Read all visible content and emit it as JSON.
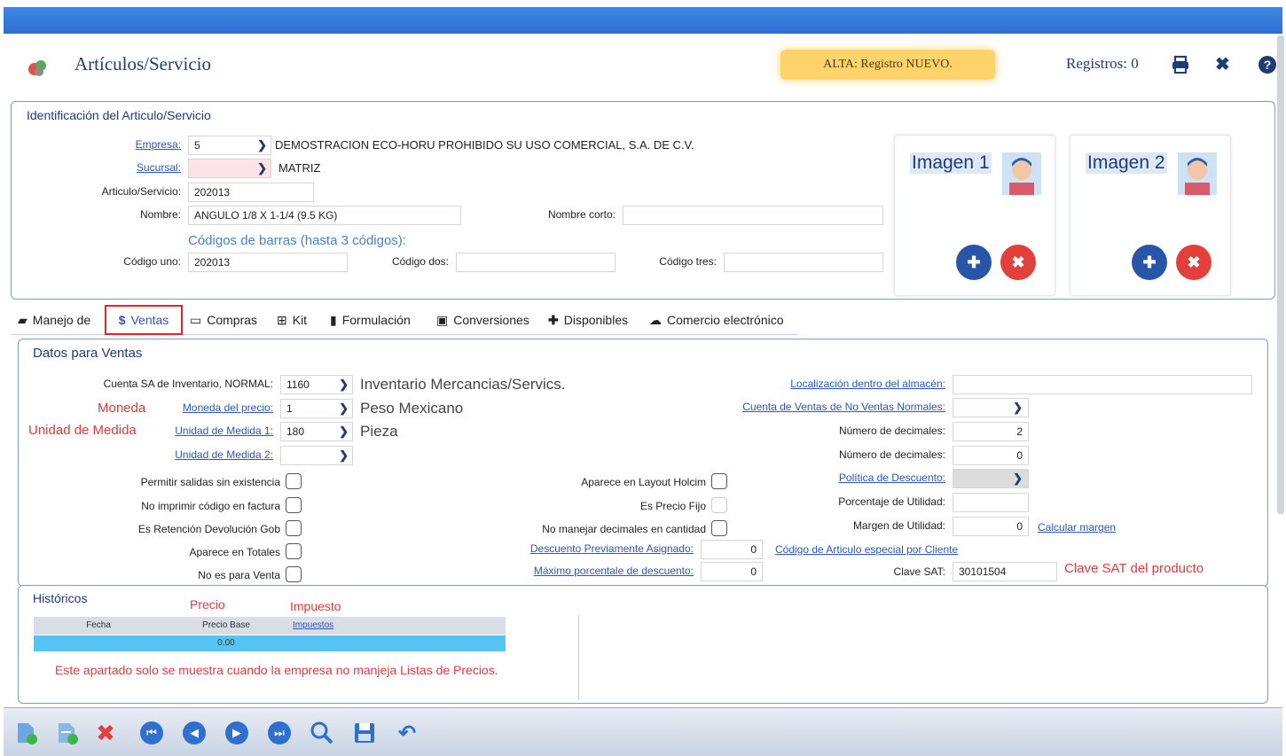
{
  "header": {
    "title": "Artículos/Servicio",
    "status": "ALTA: Registro NUEVO.",
    "registros": "Registros: 0"
  },
  "ident": {
    "title": "Identificación del Articulo/Servicio",
    "empresa_label": "Empresa:",
    "empresa_value": "5",
    "empresa_name": "DEMOSTRACION ECO-HORU PROHIBIDO SU USO COMERCIAL, S.A. DE C.V.",
    "sucursal_label": "Sucursal:",
    "sucursal_value": "",
    "sucursal_name": "MATRIZ",
    "articulo_label": "Articulo/Servicio:",
    "articulo_value": "202013",
    "nombre_label": "Nombre:",
    "nombre_value": "ANGULO 1/8 X 1-1/4 (9.5 KG)",
    "nombre_corto_label": "Nombre corto:",
    "nombre_corto_value": "",
    "barras_label": "Códigos de barras (hasta 3 códigos):",
    "codigo_uno_label": "Código uno:",
    "codigo_uno_value": "202013",
    "codigo_dos_label": "Código dos:",
    "codigo_dos_value": "",
    "codigo_tres_label": "Código tres:",
    "codigo_tres_value": "",
    "imagen1": "Imagen 1",
    "imagen2": "Imagen 2"
  },
  "tabs": [
    {
      "label": "Manejo de",
      "icon": "briefcase-icon"
    },
    {
      "label": "Ventas",
      "icon": "dollar-icon"
    },
    {
      "label": "Compras",
      "icon": "money-icon"
    },
    {
      "label": "Kit",
      "icon": "sitemap-icon"
    },
    {
      "label": "Formulación",
      "icon": "bottle-icon"
    },
    {
      "label": "Conversiones",
      "icon": "clipboard-icon"
    },
    {
      "label": "Disponibles",
      "icon": "plus-icon"
    },
    {
      "label": "Comercio electrónico",
      "icon": "cloud-icon"
    }
  ],
  "ventas": {
    "title": "Datos para Ventas",
    "cuenta_label": "Cuenta SA de Inventario, NORMAL:",
    "cuenta_value": "1160",
    "cuenta_desc": "Inventario Mercancias/Servics.",
    "moneda_annot": "Moneda",
    "moneda_label": "Moneda del precio:",
    "moneda_value": "1",
    "moneda_desc": "Peso Mexicano",
    "unidad_annot": "Unidad de Medida",
    "unidad1_label": "Unidad de Medida 1:",
    "unidad1_value": "180",
    "unidad1_desc": "Pieza",
    "unidad2_label": "Unidad de Medida 2:",
    "unidad2_value": "",
    "permitir_label": "Permitir salidas sin existencia",
    "noimprimir_label": "No imprimir código en factura",
    "retencion_label": "Es Retención Devolución Gob",
    "totales_label": "Aparece en Totales",
    "noventa_label": "No es para Venta",
    "layout_label": "Aparece en Layout Holcim",
    "preciofijo_label": "Es Precio Fijo",
    "nodecimales_label": "No manejar decimales en cantidad",
    "desc_prev_label": "Descuento Previamente Asignado:",
    "desc_prev_value": "0",
    "max_desc_label": "Máximo porcentale de descuento:",
    "max_desc_value": "0",
    "codigo_cliente_link": "Código de Articulo especial por Cliente",
    "localizacion_label": "Localización dentro del almacén:",
    "localizacion_value": "",
    "cuenta_noventas_label": "Cuenta de Ventas de No Ventas Normales:",
    "cuenta_noventas_value": "",
    "decimales1_label": "Número de decimales:",
    "decimales1_value": "2",
    "decimales2_label": "Número de decimales:",
    "decimales2_value": "0",
    "politica_label": "Política de Descuento:",
    "porcentaje_label": "Porcentaje de Utilidad:",
    "porcentaje_value": "",
    "margen_label": "Margen de Utilidad:",
    "margen_value": "0",
    "calcular_link": "Calcular margen",
    "clave_sat_label": "Clave SAT:",
    "clave_sat_value": "30101504",
    "clave_sat_annot": "Clave SAT del producto"
  },
  "historicos": {
    "title": "Históricos",
    "precio_annot": "Precio",
    "impuesto_annot": "Impuesto",
    "col_fecha": "Fecha",
    "col_precio": "Precio Base",
    "col_impuestos": "Impuestos",
    "row_precio": "0.00",
    "note": "Este apartado solo se muestra cuando la empresa no manjeja Listas de Precios."
  },
  "colors": {
    "brand": "#1f3b78",
    "accent": "#2f6fd0",
    "annotation": "#e23a3a",
    "status": "#ffd36b"
  }
}
